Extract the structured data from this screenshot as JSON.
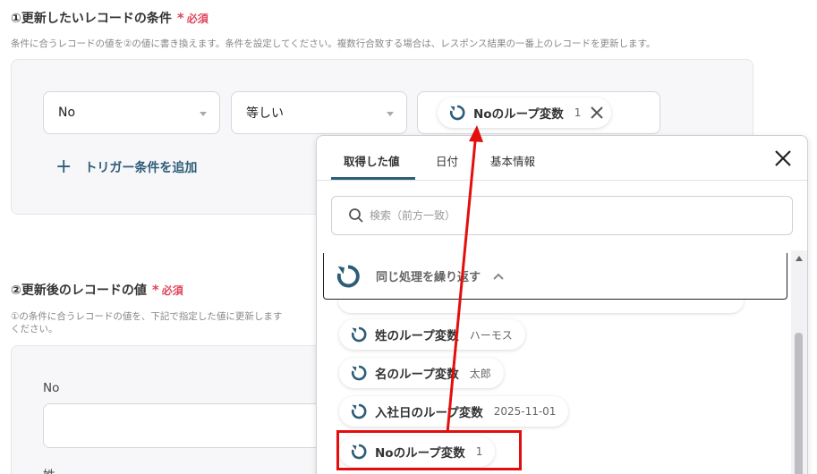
{
  "section1": {
    "title": "①更新したいレコードの条件",
    "required_label": "必須",
    "description": "条件に合うレコードの値を②の値に書き換えます。条件を設定してください。複数行合致する場合は、レスポンス結果の一番上のレコードを更新します。",
    "field_select": "No",
    "operator_select": "等しい",
    "value_chip": {
      "label": "Noのループ変数",
      "value": "1"
    },
    "add_trigger_label": "トリガー条件を追加"
  },
  "section2": {
    "title": "②更新後のレコードの値",
    "required_label": "必須",
    "description_line1": "①の条件に合うレコードの値を、下記で指定した値に更新します",
    "description_line2": "ください。",
    "field_label": "No",
    "next_field_label": "姓"
  },
  "panel": {
    "tabs": [
      "取得した値",
      "日付",
      "基本情報"
    ],
    "active_tab": 0,
    "search_placeholder": "検索（前方一致）",
    "group_label": "同じ処理を繰り返す",
    "items": [
      {
        "label": "姓のループ変数",
        "value": "ハーモス"
      },
      {
        "label": "名のループ変数",
        "value": "太郎"
      },
      {
        "label": "入社日のループ変数",
        "value": "2025-11-01"
      },
      {
        "label": "Noのループ変数",
        "value": "1"
      }
    ]
  },
  "colors": {
    "accent": "#2d5d78",
    "required": "#e2455c",
    "annotation": "#e30e0e"
  },
  "icons": {
    "loop": "loop-icon",
    "close": "close-icon",
    "search": "search-icon",
    "chevron": "chevron-up-icon",
    "plus": "plus-icon"
  }
}
